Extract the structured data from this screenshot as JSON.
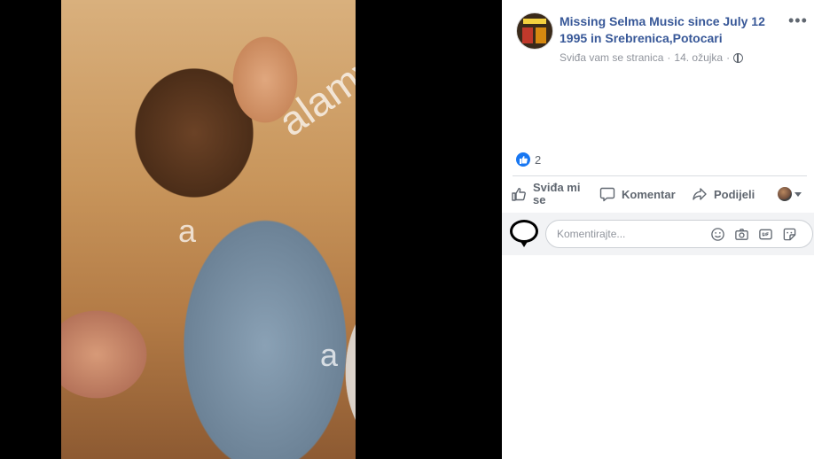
{
  "page": {
    "name": "Missing Selma Music since July 12 1995 in Srebrenica,Potocari"
  },
  "post": {
    "liked_status": "Sviđa vam se stranica",
    "date": "14. ožujka",
    "dot": "·"
  },
  "photo": {
    "watermark": "alamy",
    "watermark_small": "a"
  },
  "reactions": {
    "count": "2"
  },
  "actions": {
    "like": "Sviđa mi se",
    "comment": "Komentar",
    "share": "Podijeli"
  },
  "comment": {
    "placeholder": "Komentirajte..."
  },
  "colors": {
    "link": "#385898",
    "accent": "#1877f2",
    "muted": "#90949c"
  }
}
